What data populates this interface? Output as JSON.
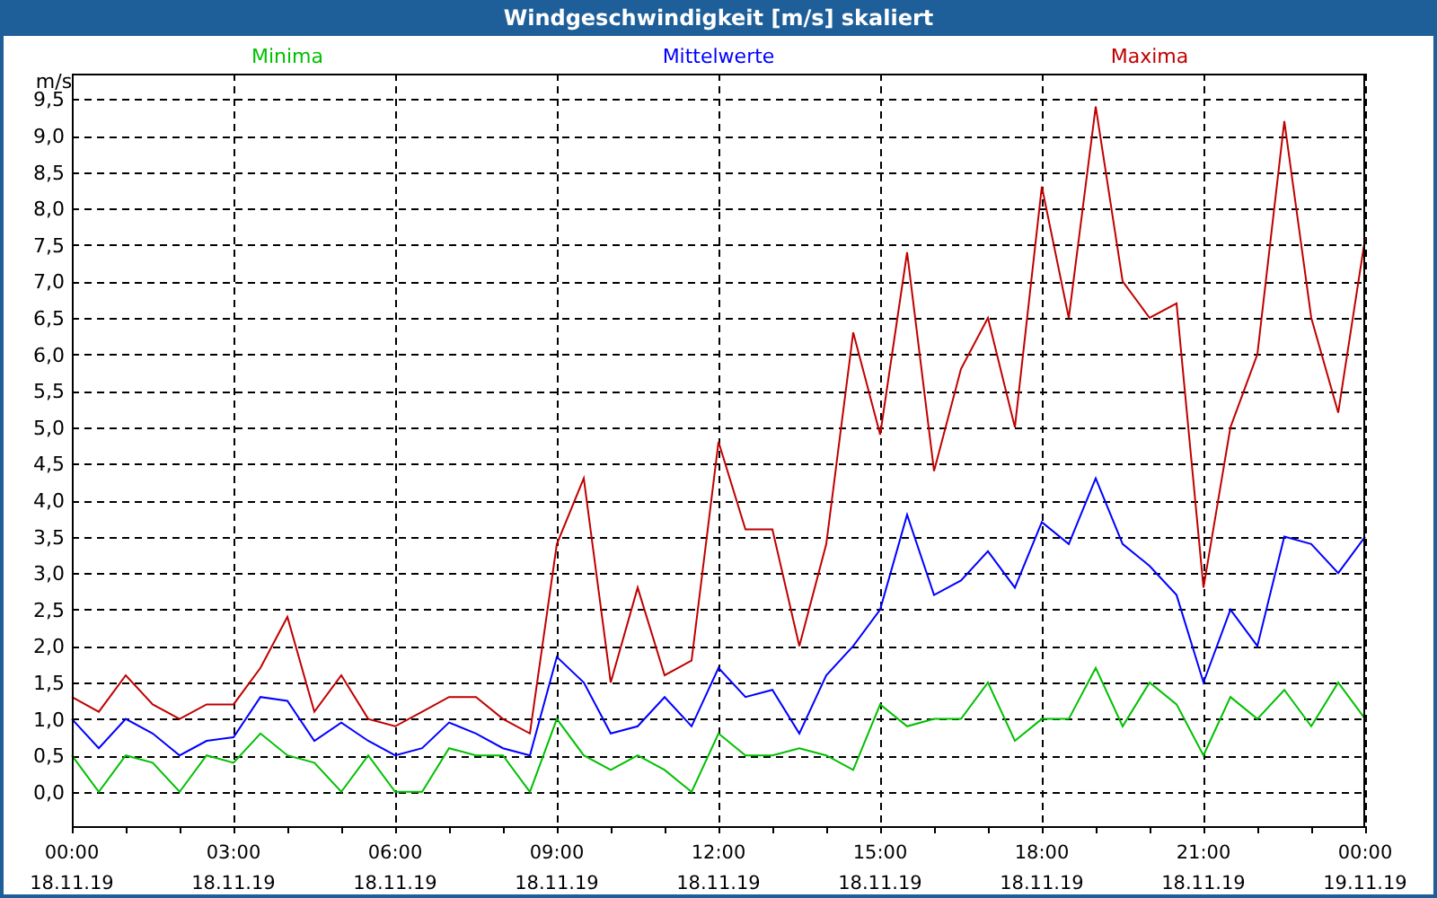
{
  "window": {
    "title": "Windgeschwindigkeit [m/s] skaliert"
  },
  "chart": {
    "chart_data": {
      "type": "line",
      "ylabel": "m/s",
      "categories": [
        "00:00\n18.11.19",
        null,
        null,
        null,
        null,
        null,
        "03:00\n18.11.19",
        null,
        null,
        null,
        null,
        null,
        "06:00\n18.11.19",
        null,
        null,
        null,
        null,
        null,
        "09:00\n18.11.19",
        null,
        null,
        null,
        null,
        null,
        "12:00\n18.11.19",
        null,
        null,
        null,
        null,
        null,
        "15:00\n18.11.19",
        null,
        null,
        null,
        null,
        null,
        "18:00\n18.11.19",
        null,
        null,
        null,
        null,
        null,
        "21:00\n18.11.19",
        null,
        null,
        null,
        null,
        null,
        "00:00\n19.11.19"
      ],
      "series": [
        {
          "name": "Minima",
          "color": "#00c000",
          "values": [
            0.5,
            0.0,
            0.5,
            0.4,
            0.0,
            0.5,
            0.4,
            0.8,
            0.5,
            0.4,
            0.0,
            0.5,
            0.0,
            0.0,
            0.6,
            0.5,
            0.5,
            0.0,
            1.0,
            0.5,
            0.3,
            0.5,
            0.3,
            0.0,
            0.8,
            0.5,
            0.5,
            0.6,
            0.5,
            0.3,
            1.2,
            0.9,
            1.0,
            1.0,
            1.5,
            0.7,
            1.0,
            1.0,
            1.7,
            0.9,
            1.5,
            1.2,
            0.5,
            1.3,
            1.0,
            1.4,
            0.9,
            1.5,
            1.0
          ]
        },
        {
          "name": "Mittelwerte",
          "color": "#0000ff",
          "values": [
            1.0,
            0.6,
            1.0,
            0.8,
            0.5,
            0.7,
            0.75,
            1.3,
            1.25,
            0.7,
            0.95,
            0.7,
            0.5,
            0.6,
            0.95,
            0.8,
            0.6,
            0.5,
            1.85,
            1.5,
            0.8,
            0.9,
            1.3,
            0.9,
            1.7,
            1.3,
            1.4,
            0.8,
            1.6,
            2.0,
            2.5,
            3.8,
            2.7,
            2.9,
            3.3,
            2.8,
            3.7,
            3.4,
            4.3,
            3.4,
            3.1,
            2.7,
            1.5,
            2.5,
            2.0,
            3.5,
            3.4,
            3.0,
            3.5
          ]
        },
        {
          "name": "Maxima",
          "color": "#c00000",
          "values": [
            1.3,
            1.1,
            1.6,
            1.2,
            1.0,
            1.2,
            1.2,
            1.7,
            2.4,
            1.1,
            1.6,
            1.0,
            0.9,
            1.1,
            1.3,
            1.3,
            1.0,
            0.8,
            3.4,
            4.3,
            1.5,
            2.8,
            1.6,
            1.8,
            4.8,
            3.6,
            3.6,
            2.0,
            3.4,
            6.3,
            4.9,
            7.4,
            4.4,
            5.8,
            6.5,
            5.0,
            8.3,
            6.5,
            9.4,
            7.0,
            6.5,
            6.7,
            2.8,
            5.0,
            6.0,
            9.2,
            6.5,
            5.2,
            7.6
          ]
        }
      ],
      "ylim": [
        -0.47,
        9.85
      ],
      "grid": true,
      "yticks": [
        {
          "value": 0,
          "label": "0,0"
        },
        {
          "value": 0.5,
          "label": "0,5"
        },
        {
          "value": 1,
          "label": "1,0"
        },
        {
          "value": 1.5,
          "label": "1,5"
        },
        {
          "value": 2,
          "label": "2,0"
        },
        {
          "value": 2.5,
          "label": "2,5"
        },
        {
          "value": 3,
          "label": "3,0"
        },
        {
          "value": 3.5,
          "label": "3,5"
        },
        {
          "value": 4,
          "label": "4,0"
        },
        {
          "value": 4.5,
          "label": "4,5"
        },
        {
          "value": 5,
          "label": "5,0"
        },
        {
          "value": 5.5,
          "label": "5,5"
        },
        {
          "value": 6,
          "label": "6,0"
        },
        {
          "value": 6.5,
          "label": "6,5"
        },
        {
          "value": 7,
          "label": "7,0"
        },
        {
          "value": 7.5,
          "label": "7,5"
        },
        {
          "value": 8,
          "label": "8,0"
        },
        {
          "value": 8.5,
          "label": "8,5"
        },
        {
          "value": 9,
          "label": "9,0"
        },
        {
          "value": 9.5,
          "label": "9,5"
        }
      ]
    }
  }
}
